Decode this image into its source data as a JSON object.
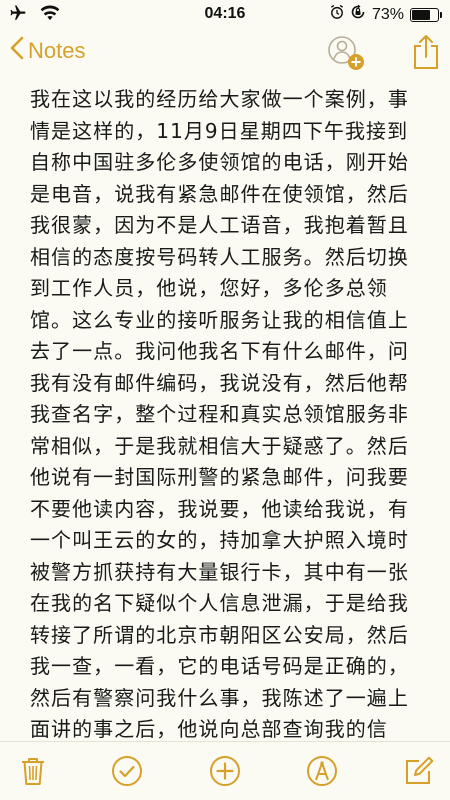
{
  "status_bar": {
    "time": "04:16",
    "battery_percent": "73%",
    "battery_level": 0.73
  },
  "nav": {
    "back_label": "Notes",
    "accent_color": "#d6a02b"
  },
  "note": {
    "text": "我在这以我的经历给大家做一个案例，事情是这样的，11月9日星期四下午我接到自称中国驻多伦多使领馆的电话，刚开始是电音，说我有紧急邮件在使领馆，然后我很蒙，因为不是人工语音，我抱着暂且相信的态度按号码转人工服务。然后切换到工作人员，他说，您好，多伦多总领馆。这么专业的接听服务让我的相信值上去了一点。我问他我名下有什么邮件，问我有没有邮件编码，我说没有，然后他帮我查名字，整个过程和真实总领馆服务非常相似，于是我就相信大于疑惑了。然后他说有一封国际刑警的紧急邮件，问我要不要他读内容，我说要，他读给我说，有一个叫王云的女的，持加拿大护照入境时被警方抓获持有大量银行卡，其中有一张在我的名下疑似个人信息泄漏，于是给我转接了所谓的北京市朝阳区公安局，然后我一查，一看，它的电话号码是正确的，然后有警察问我什么事，我陈述了一遍上面讲的事之后，他说向总部查询我的信息，非常的专业，技巧娴熟，很容易让人相信，总部回电也非常专业，我在电话里有听到"
  },
  "icons": {
    "airplane": "airplane-icon",
    "wifi": "wifi-icon",
    "alarm": "alarm-icon",
    "orientation_lock": "orientation-lock-icon",
    "battery": "battery-icon",
    "back": "chevron-left-icon",
    "add_people": "add-people-icon",
    "share": "share-icon",
    "trash": "trash-icon",
    "checklist": "checklist-icon",
    "add": "add-icon",
    "sketch": "sketch-icon",
    "compose": "compose-icon"
  }
}
